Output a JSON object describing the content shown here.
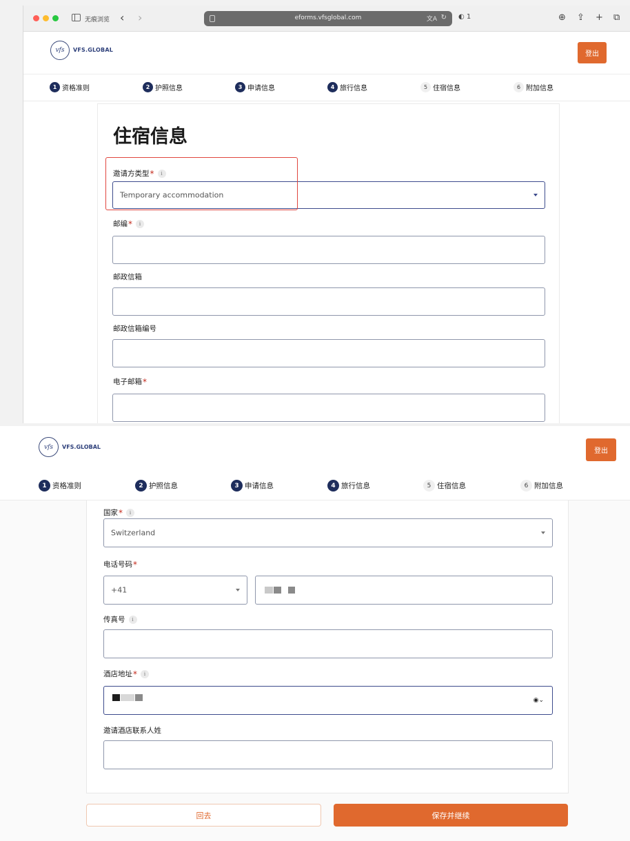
{
  "browser": {
    "private_label": "无痕浏览",
    "url": "eforms.vfsglobal.com",
    "translate_glyph": "文A",
    "reload_glyph": "↻",
    "shield_count": "1"
  },
  "header": {
    "logo_mark": "vfs",
    "logo_text": "VFS.GLOBAL",
    "logout_label": "登出"
  },
  "steps": [
    {
      "num": "1",
      "label": "资格准则"
    },
    {
      "num": "2",
      "label": "护照信息"
    },
    {
      "num": "3",
      "label": "申请信息"
    },
    {
      "num": "4",
      "label": "旅行信息"
    },
    {
      "num": "5",
      "label": "住宿信息"
    },
    {
      "num": "6",
      "label": "附加信息"
    }
  ],
  "form_top": {
    "title": "住宿信息",
    "inviter_type": {
      "label": "邀请方类型",
      "required": "*",
      "value": "Temporary accommodation"
    },
    "postcode": {
      "label": "邮编",
      "required": "*",
      "value": ""
    },
    "po_box": {
      "label": "邮政信箱",
      "value": ""
    },
    "po_box_number": {
      "label": "邮政信箱编号",
      "value": ""
    },
    "email": {
      "label": "电子邮箱",
      "required": "*",
      "value": ""
    }
  },
  "form_bottom": {
    "country": {
      "label": "国家",
      "required": "*",
      "value": "Switzerland"
    },
    "phone": {
      "label": "电话号码",
      "required": "*",
      "code": "+41"
    },
    "fax": {
      "label": "传真号",
      "value": ""
    },
    "hotel_address": {
      "label": "酒店地址",
      "required": "*"
    },
    "hotel_contact_surname": {
      "label": "邀请酒店联系人姓",
      "value": ""
    }
  },
  "actions": {
    "back_label": "回去",
    "save_label": "保存并继续"
  },
  "colors": {
    "accent": "#e0692e",
    "step_dark": "#1e2d5c",
    "required": "#c42a1c",
    "highlight": "#e0453d"
  }
}
